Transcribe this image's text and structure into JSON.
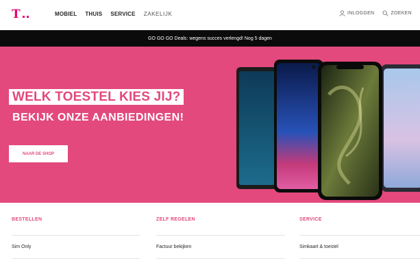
{
  "header": {
    "nav": [
      {
        "label": "MOBIEL"
      },
      {
        "label": "THUIS"
      },
      {
        "label": "SERVICE"
      },
      {
        "label": "ZAKELIJK"
      }
    ],
    "login_label": "INLOGGEN",
    "search_label": "ZOEKEN"
  },
  "promo": {
    "text": "GO GO GO Deals: wegens succes verlengd! Nog 5 dagen"
  },
  "hero": {
    "title": "WELK TOESTEL KIES JIJ?",
    "subtitle": "BEKIJK ONZE AANBIEDINGEN!",
    "button_label": "NAAR DE SHOP"
  },
  "columns": [
    {
      "heading": "BESTELLEN",
      "link": "Sim Only"
    },
    {
      "heading": "ZELF REGELEN",
      "link": "Factuur bekijken"
    },
    {
      "heading": "SERVICE",
      "link": "Simkaart & toestel"
    }
  ],
  "colors": {
    "brand": "#e20074",
    "hero_bg": "#e3497c",
    "promo_bg": "#0b0b0b"
  }
}
